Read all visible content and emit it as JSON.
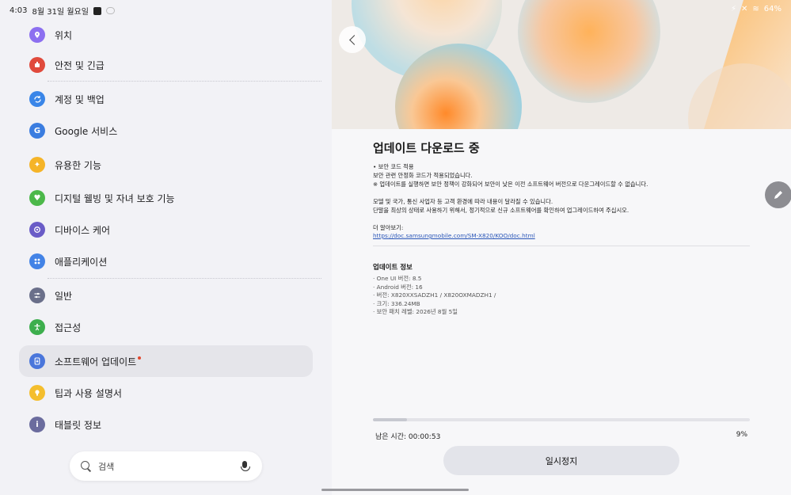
{
  "status_bar": {
    "time": "4:03",
    "date": "8월 31일 월요일",
    "battery": "64%",
    "icons": [
      "vibrate-icon",
      "mute-icon",
      "wifi-icon",
      "battery-icon"
    ]
  },
  "sidebar": {
    "items": [
      {
        "label": "위치",
        "icon": "location-icon",
        "color": "#8c6ff0"
      },
      {
        "label": "안전 및 긴급",
        "icon": "emergency-icon",
        "color": "#e04a3c"
      },
      {
        "label": "계정 및 백업",
        "icon": "sync-icon",
        "color": "#3a86e8"
      },
      {
        "label": "Google 서비스",
        "icon": "google-icon",
        "color": "#3b7de0"
      },
      {
        "label": "유용한 기능",
        "icon": "star-icon",
        "color": "#f5b428"
      },
      {
        "label": "디지털 웰빙 및 자녀 보호 기능",
        "icon": "wellbeing-icon",
        "color": "#4cb84a"
      },
      {
        "label": "디바이스 케어",
        "icon": "device-care-icon",
        "color": "#6a5cc7"
      },
      {
        "label": "애플리케이션",
        "icon": "apps-icon",
        "color": "#4383e6"
      },
      {
        "label": "일반",
        "icon": "sliders-icon",
        "color": "#6a6f8a"
      },
      {
        "label": "접근성",
        "icon": "accessibility-icon",
        "color": "#3dae4d"
      },
      {
        "label": "소프트웨어 업데이트",
        "icon": "software-update-icon",
        "color": "#4a76db"
      },
      {
        "label": "팁과 사용 설명서",
        "icon": "tips-icon",
        "color": "#f4be2e"
      },
      {
        "label": "태블릿 정보",
        "icon": "info-icon",
        "color": "#6b6c9e"
      }
    ],
    "search_placeholder": "검색"
  },
  "detail": {
    "title": "업데이트 다운로드 중",
    "notes_line1": "• 보안 코드 적용",
    "notes_line2": "보안 관련 안정화 코드가 적용되었습니다.",
    "notes_line3": "※ 업데이트를 실행하면 보안 정책이 강화되어 보안이 낮은 이전 소프트웨어 버전으로 다운그레이드할 수 없습니다.",
    "notes_line4": "모델 및 국가, 통신 사업자 등 고객 환경에 따라 내용이 달라질 수 있습니다.",
    "notes_line5": "단말을 최상의 상태로 사용하기 위해서, 정기적으로 신규 소프트웨어를 확인하여 업그레이드하여 주십시오.",
    "more_label": "더 알아보기:",
    "more_link": "https://doc.samsungmobile.com/SM-X820/KOO/doc.html",
    "info_title": "업데이트 정보",
    "info_lines": [
      "· One UI 버전: 8.5",
      "· Android 버전: 16",
      "· 버전: X820XXSADZH1 / X820OXMADZH1 /",
      "· 크기: 336.24MB",
      "· 보안 패치 레벨: 2026년 8월 5일"
    ],
    "progress_fraction": 0.09,
    "remaining_time": "남은 시간: 00:00:53",
    "percent_text": "9%",
    "pause_label": "일시정지"
  }
}
